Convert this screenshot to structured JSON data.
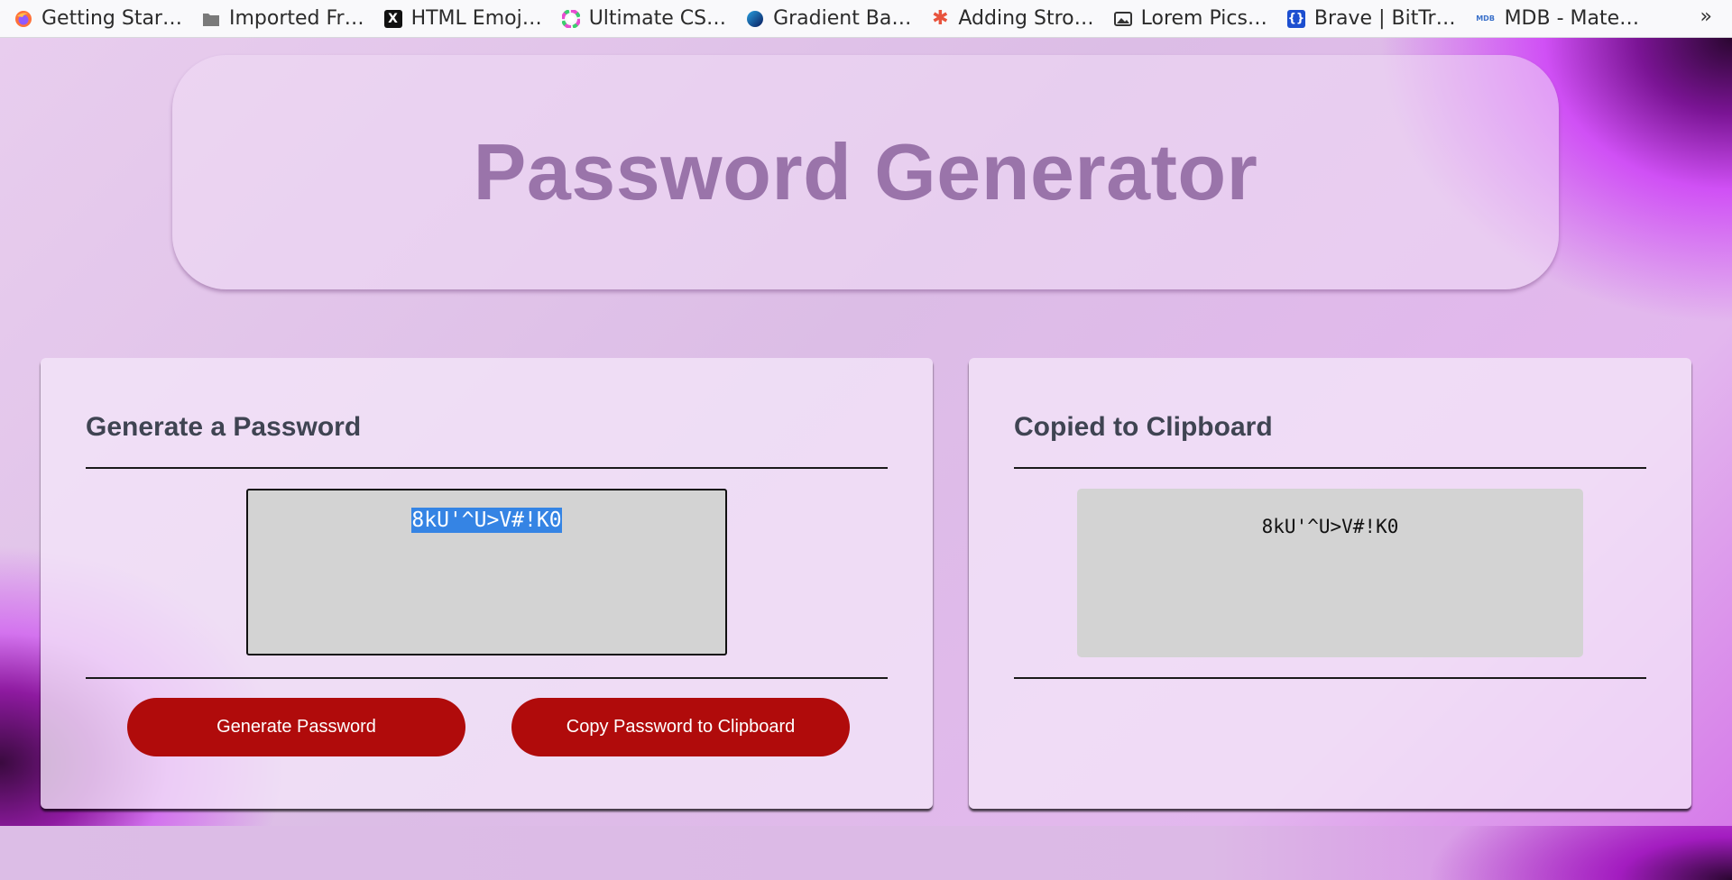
{
  "bookmarks": {
    "items": [
      {
        "label": "Getting Star…",
        "icon": "firefox-icon"
      },
      {
        "label": "Imported Fr…",
        "icon": "folder-icon"
      },
      {
        "label": "HTML Emoj…",
        "icon": "x-logo-icon"
      },
      {
        "label": "Ultimate CS…",
        "icon": "color-wheel-icon"
      },
      {
        "label": "Gradient Ba…",
        "icon": "gradient-circle-icon"
      },
      {
        "label": "Adding Stro…",
        "icon": "asterisk-icon"
      },
      {
        "label": "Lorem Pics…",
        "icon": "image-icon"
      },
      {
        "label": "Brave | BitTr…",
        "icon": "bracket-icon"
      },
      {
        "label": "MDB - Mate…",
        "icon": "mdb-icon"
      }
    ],
    "overflow": "»"
  },
  "header": {
    "title": "Password Generator"
  },
  "generate_card": {
    "title": "Generate a Password",
    "password_value": "8kU'^U>V#!K0",
    "generate_button": "Generate Password",
    "copy_button": "Copy Password to Clipboard"
  },
  "clipboard_card": {
    "title": "Copied to Clipboard",
    "copied_value": "8kU'^U>V#!K0"
  },
  "colors": {
    "button": "#b00b0b",
    "title": "#9a74aa",
    "card_heading": "#3f4452",
    "selection": "#3584e4"
  }
}
